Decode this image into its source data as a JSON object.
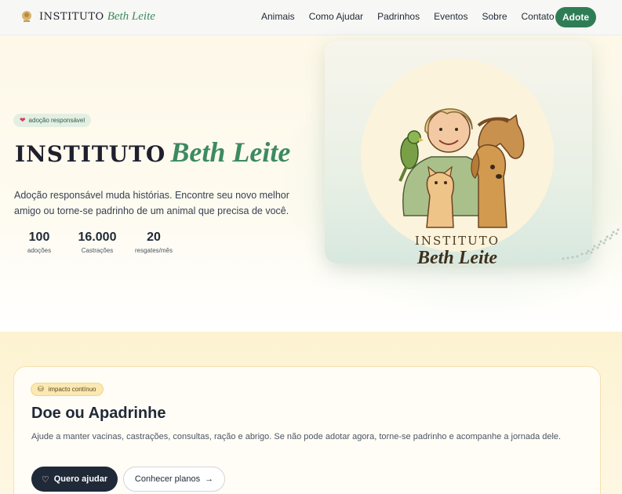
{
  "nav": {
    "brand_word1": "INSTITUTO",
    "brand_word2": "Beth Leite",
    "links": [
      "Animais",
      "Como Ajudar",
      "Padrinhos",
      "Eventos",
      "Sobre",
      "Contato"
    ],
    "adopt_label": "Adote"
  },
  "hero": {
    "badge": "adoção responsável",
    "title_word1": "INSTITUTO",
    "title_word2": "Beth Leite",
    "description": "Adoção responsável muda histórias. Encontre seu novo melhor amigo ou torne-se padrinho de um animal que precisa de você.",
    "stats": [
      {
        "value": "100",
        "label": "adoções"
      },
      {
        "value": "16.000",
        "label": "Castrações"
      },
      {
        "value": "20",
        "label": "resgates/mês"
      }
    ],
    "logo_text_line1": "INSTITUTO",
    "logo_text_line2": "Beth Leite"
  },
  "donate": {
    "badge": "impacto contínuo",
    "title": "Doe ou Apadrinhe",
    "description": "Ajude a manter vacinas, castrações, consultas, ração e abrigo. Se não pode adotar agora, torne-se padrinho e acompanhe a jornada dele.",
    "primary_label": "Quero ajudar",
    "secondary_label": "Conhecer planos"
  },
  "colors": {
    "accent_green": "#2f7d55",
    "brand_green": "#3d8a5f",
    "dark": "#1f2937",
    "cream": "#fdf8e8"
  }
}
